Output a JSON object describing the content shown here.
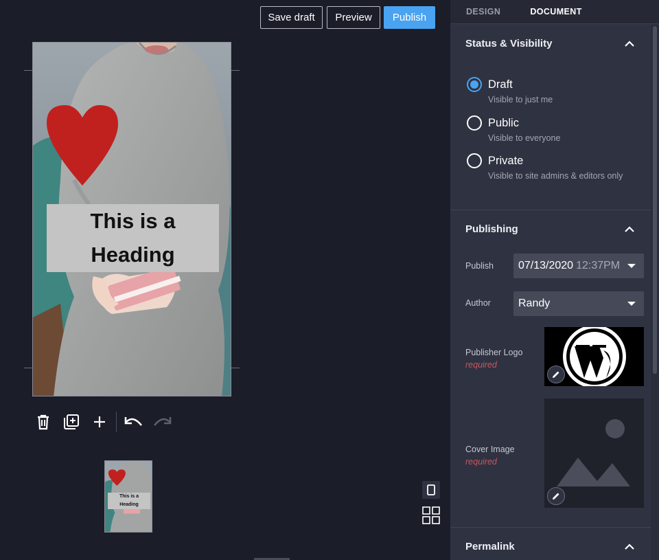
{
  "header": {
    "save_draft_label": "Save draft",
    "preview_label": "Preview",
    "publish_label": "Publish"
  },
  "canvas": {
    "page_heading_line1": "This is a",
    "page_heading_line2": "Heading",
    "thumbnail_heading_line1": "This is a",
    "thumbnail_heading_line2": "Heading",
    "toolbar": [
      "trash-icon",
      "duplicate-icon",
      "add-icon",
      "undo-icon",
      "redo-icon"
    ]
  },
  "sidebar": {
    "tabs": [
      {
        "label": "DESIGN",
        "active": false
      },
      {
        "label": "DOCUMENT",
        "active": true
      }
    ],
    "status_panel": {
      "title": "Status & Visibility",
      "options": [
        {
          "label": "Draft",
          "description": "Visible to just me",
          "checked": true
        },
        {
          "label": "Public",
          "description": "Visible to everyone",
          "checked": false
        },
        {
          "label": "Private",
          "description": "Visible to site admins & editors only",
          "checked": false
        }
      ]
    },
    "publishing_panel": {
      "title": "Publishing",
      "publish_label": "Publish",
      "publish_date": "07/13/2020",
      "publish_time": "12:37PM",
      "author_label": "Author",
      "author_value": "Randy",
      "publisher_logo_label": "Publisher Logo",
      "publisher_logo_required": "required",
      "cover_image_label": "Cover Image",
      "cover_image_required": "required"
    },
    "permalink_panel": {
      "title": "Permalink"
    }
  },
  "colors": {
    "accent": "#4aa3f0",
    "heart": "#c0211f",
    "required": "#c9575f"
  }
}
